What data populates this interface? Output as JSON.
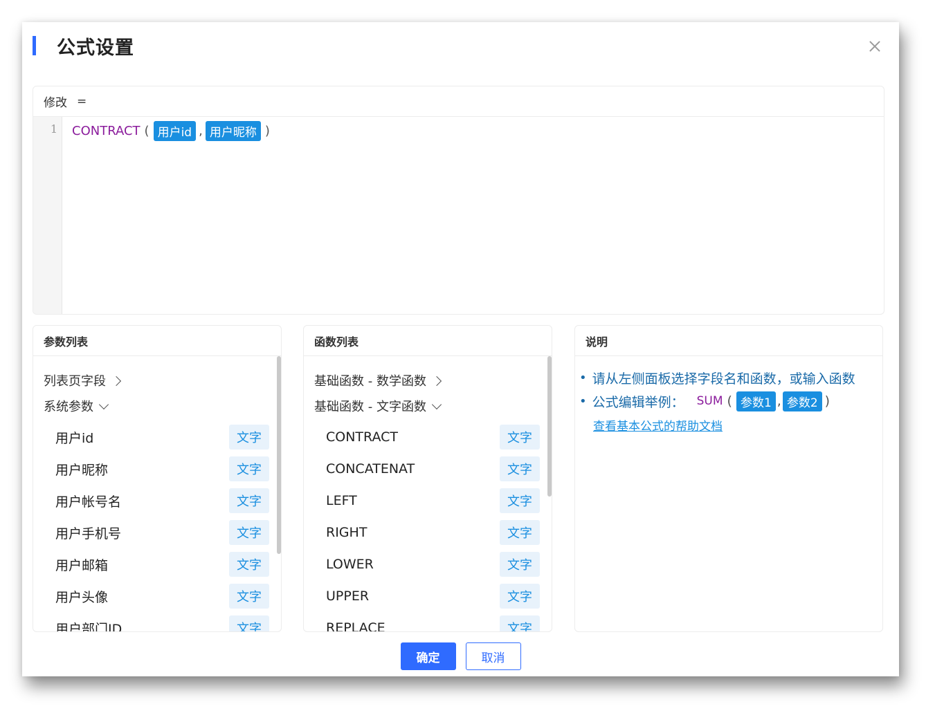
{
  "dialog": {
    "title": "公式设置"
  },
  "editor": {
    "header_label": "修改",
    "header_eq": "=",
    "line_number": "1",
    "function_name": "CONTRACT",
    "open_paren": "(",
    "close_paren": ")",
    "separator": ",",
    "args": [
      "用户id",
      "用户昵称"
    ]
  },
  "params_panel": {
    "title": "参数列表",
    "groups": [
      {
        "label": "列表页字段",
        "expanded": false
      },
      {
        "label": "系统参数",
        "expanded": true
      }
    ],
    "items": [
      {
        "label": "用户id",
        "type": "文字"
      },
      {
        "label": "用户昵称",
        "type": "文字"
      },
      {
        "label": "用户帐号名",
        "type": "文字"
      },
      {
        "label": "用户手机号",
        "type": "文字"
      },
      {
        "label": "用户邮箱",
        "type": "文字"
      },
      {
        "label": "用户头像",
        "type": "文字"
      },
      {
        "label": "用户部门ID",
        "type": "文字"
      }
    ]
  },
  "functions_panel": {
    "title": "函数列表",
    "groups": [
      {
        "label": "基础函数 - 数学函数",
        "expanded": false
      },
      {
        "label": "基础函数 - 文字函数",
        "expanded": true
      }
    ],
    "items": [
      {
        "label": "CONTRACT",
        "type": "文字"
      },
      {
        "label": "CONCATENAT",
        "type": "文字"
      },
      {
        "label": "LEFT",
        "type": "文字"
      },
      {
        "label": "RIGHT",
        "type": "文字"
      },
      {
        "label": "LOWER",
        "type": "文字"
      },
      {
        "label": "UPPER",
        "type": "文字"
      },
      {
        "label": "REPLACE",
        "type": "文字"
      }
    ]
  },
  "description": {
    "title": "说明",
    "line1": "请从左侧面板选择字段名和函数，或输入函数",
    "line2_label": "公式编辑举例：",
    "example_fn": "SUM",
    "example_open": "(",
    "example_close": ")",
    "example_sep": ",",
    "example_args": [
      "参数1",
      "参数2"
    ],
    "help_link": "查看基本公式的帮助文档"
  },
  "footer": {
    "confirm": "确定",
    "cancel": "取消"
  },
  "colors": {
    "accent": "#2f6bff",
    "chip": "#1a8fe0",
    "function": "#8b1c9c",
    "tag_bg": "#e8f2fb"
  }
}
